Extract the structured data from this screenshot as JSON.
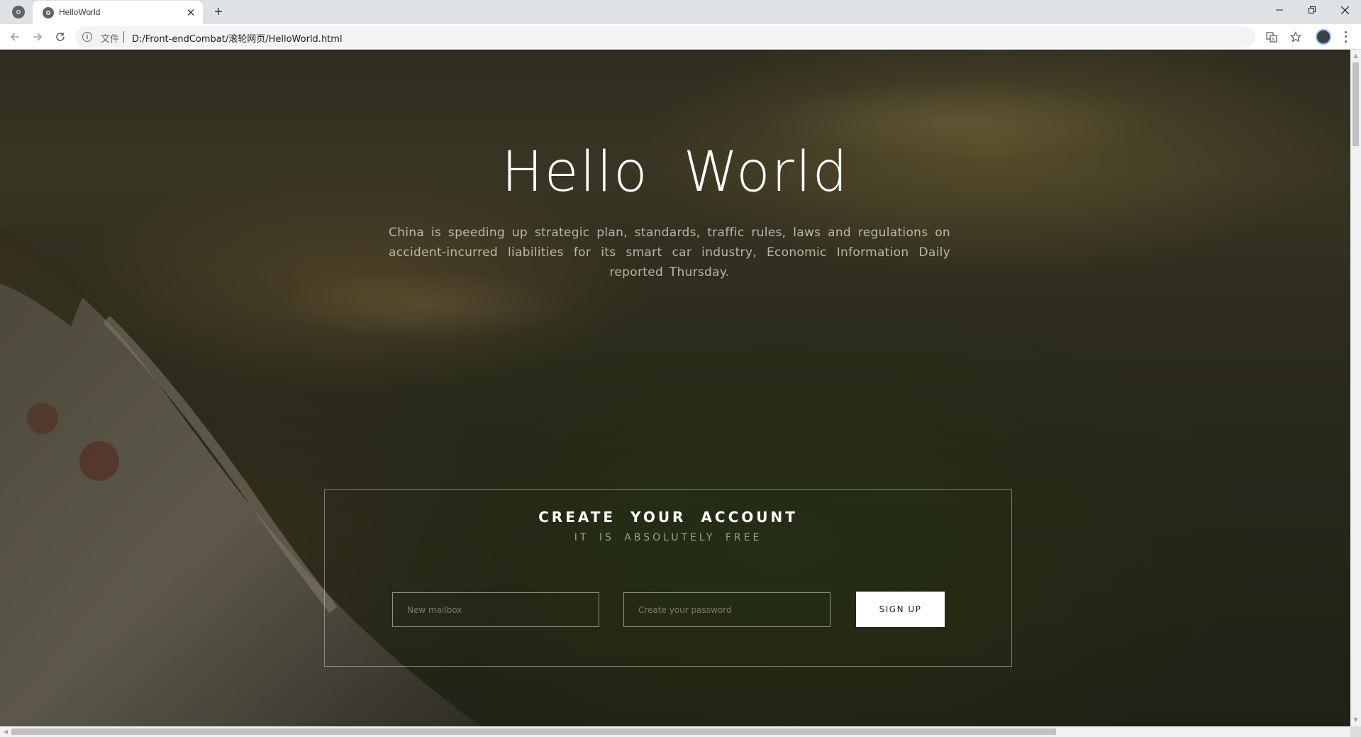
{
  "browser": {
    "tab_title": "HelloWorld",
    "tab_close_glyph": "✕",
    "new_tab_glyph": "+",
    "address": {
      "scheme_label": "文件",
      "url": "D:/Front-endCombat/滚轮网页/HelloWorld.html"
    },
    "icons": {
      "chrome_logo": "chrome-icon",
      "favicon": "globe-icon",
      "back": "arrow-left-icon",
      "forward": "arrow-right-icon",
      "reload": "reload-icon",
      "info": "info-icon",
      "translate": "translate-icon",
      "bookmark": "star-icon",
      "profile": "profile-icon",
      "menu": "kebab-menu-icon"
    }
  },
  "page": {
    "hero": {
      "title": "Hello World",
      "description": "China is speeding up strategic plan, standards, traffic rules, laws and regulations on accident-incurred liabilities for its smart car industry, Economic Information Daily reported Thursday."
    },
    "signup": {
      "title": "CREATE YOUR ACCOUNT",
      "subtitle": "IT IS ABSOLUTELY FREE",
      "email_placeholder": "New mailbox",
      "password_placeholder": "Create your password",
      "button_label": "SIGN UP"
    }
  },
  "colors": {
    "chrome_bg": "#dee1e6",
    "toolbar_bg": "#ffffff",
    "omnibox_bg": "#f1f3f4",
    "hero_text": "#ffffff",
    "button_bg": "#ffffff",
    "button_text": "#222222"
  }
}
